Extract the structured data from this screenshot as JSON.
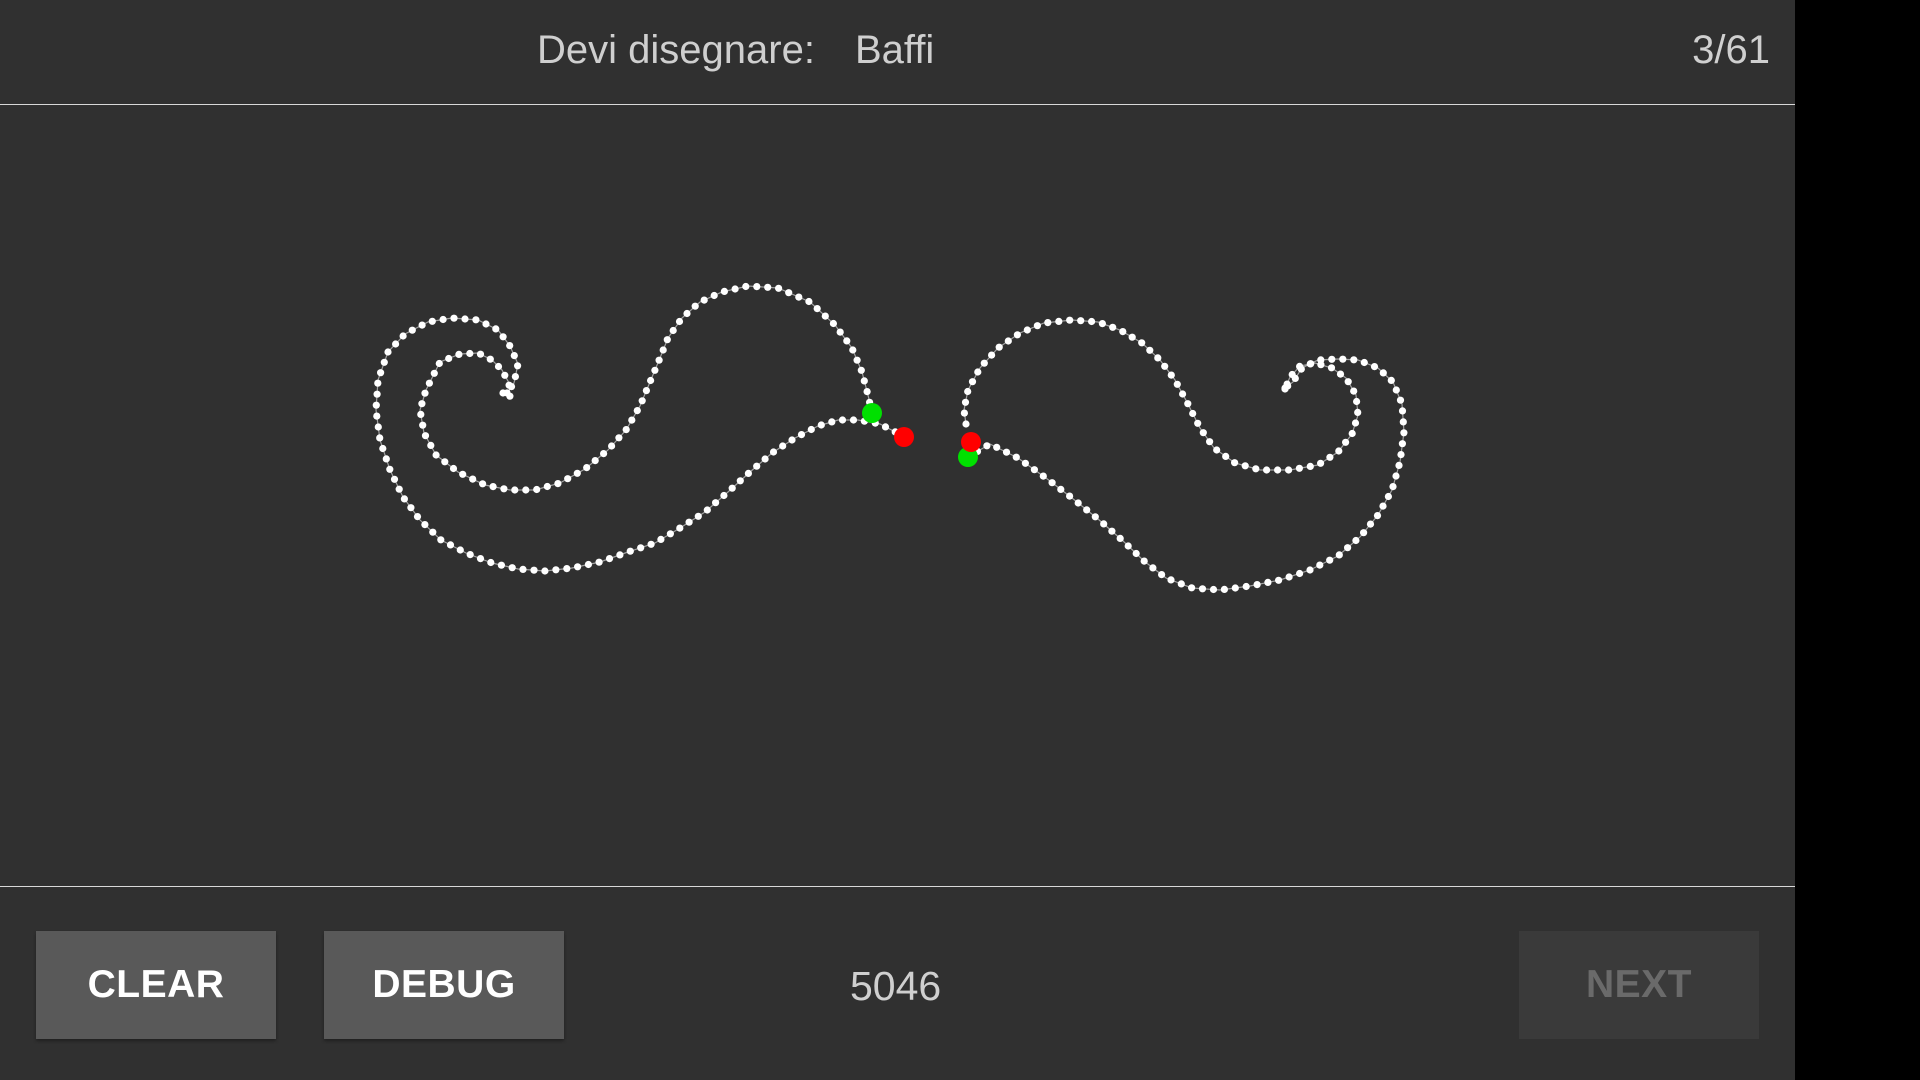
{
  "header": {
    "prompt_label": "Devi disegnare:",
    "prompt_word": "Baffi",
    "progress": "3/61"
  },
  "footer": {
    "clear_label": "CLEAR",
    "debug_label": "DEBUG",
    "score": "5046",
    "next_label": "NEXT"
  },
  "colors": {
    "background": "#303030",
    "stroke_point": "#ffffff",
    "start_marker": "#00e000",
    "end_marker": "#ff0000",
    "next_disabled_text": "#6a6a6a"
  },
  "state": {
    "next_enabled": false
  }
}
